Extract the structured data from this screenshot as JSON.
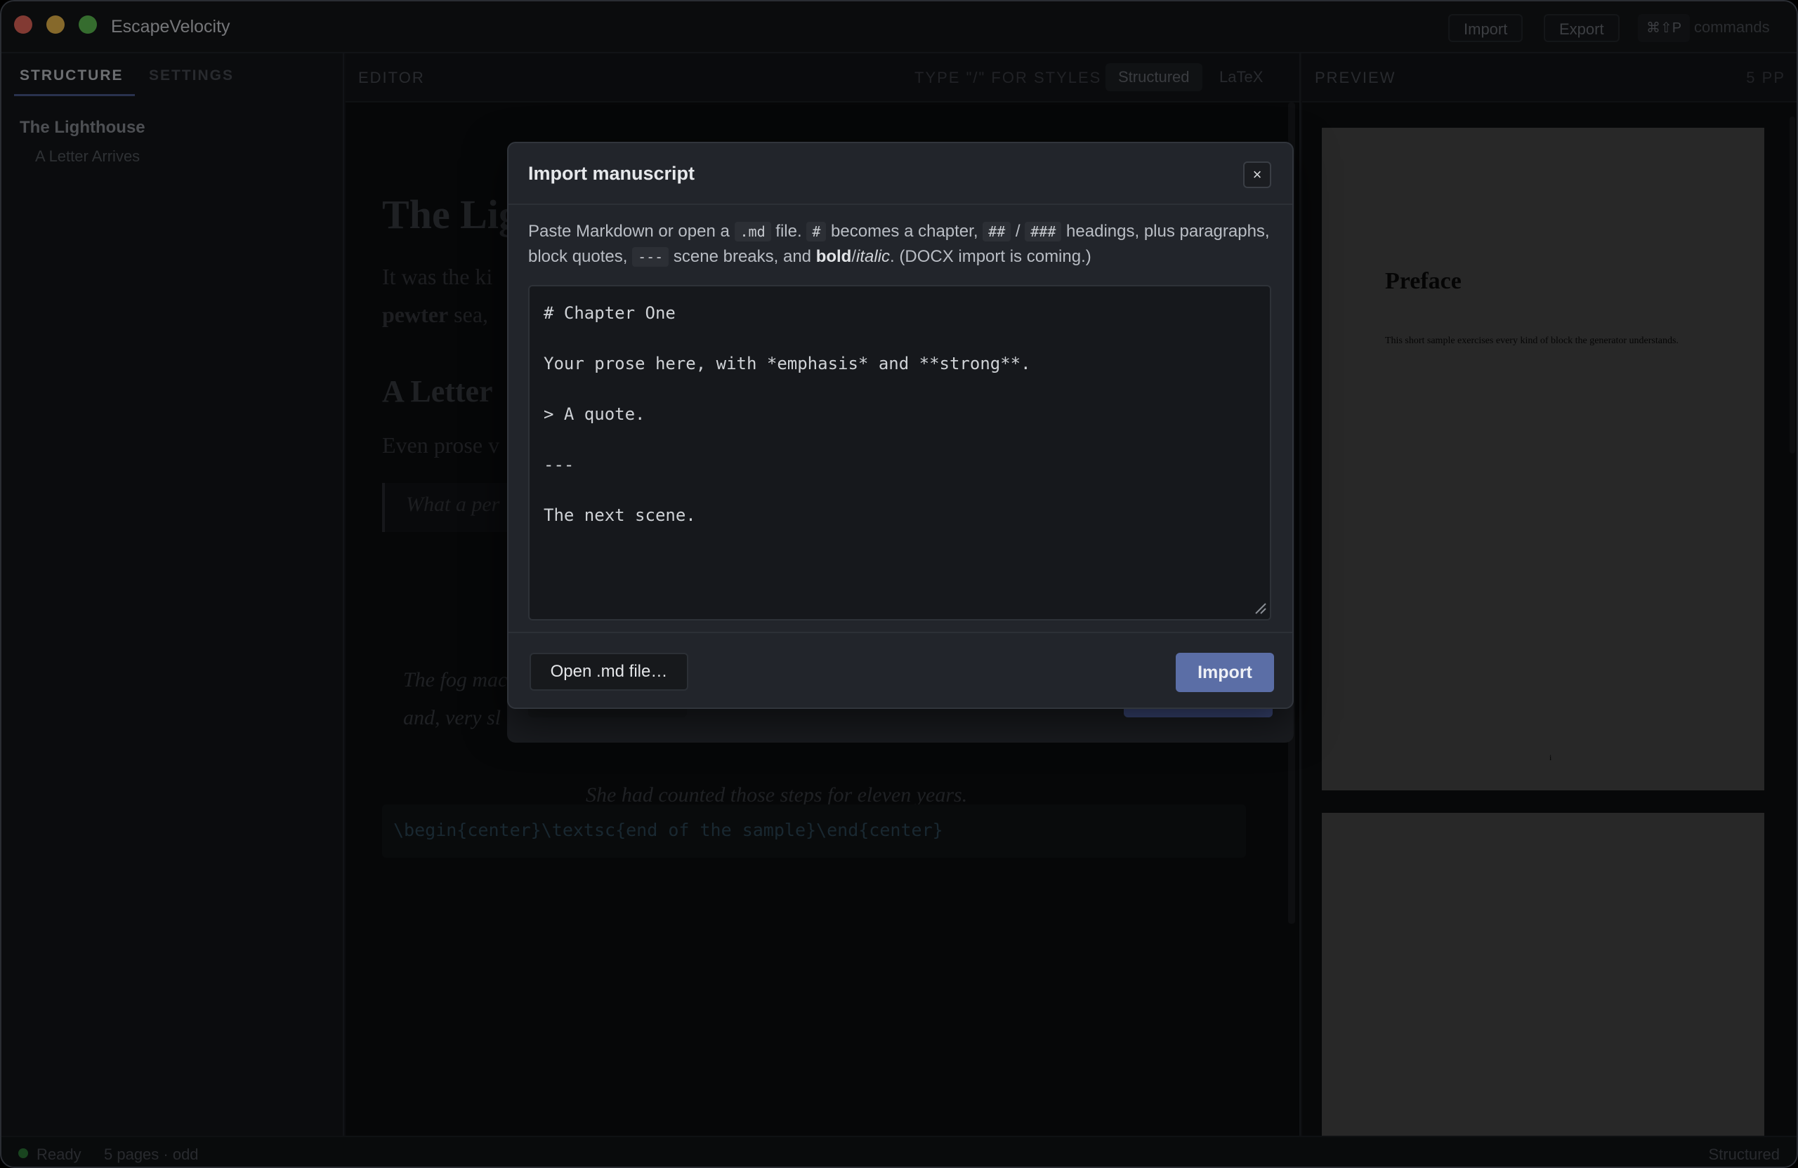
{
  "app": {
    "title": "EscapeVelocity",
    "import_label": "Import",
    "export_label": "Export",
    "shortcut": "⌘⇧P",
    "commands_label": "commands"
  },
  "sidebar": {
    "tabs": [
      {
        "label": "STRUCTURE"
      },
      {
        "label": "SETTINGS"
      }
    ],
    "items": [
      {
        "label": "The Lighthouse"
      },
      {
        "label": "A Letter Arrives"
      }
    ]
  },
  "editor": {
    "label": "EDITOR",
    "style_hint": "TYPE \"/\" FOR STYLES",
    "modes": [
      {
        "label": "Structured"
      },
      {
        "label": "LaTeX"
      }
    ],
    "doc": {
      "h1": "The Lig",
      "p1_line1": "It was the ki",
      "p1_line2_bold": "pewter",
      "p1_line2_rest": " sea,",
      "h2": "A Letter",
      "p2": "Even prose v",
      "quote": "What a per",
      "ital1": "The fog mac",
      "ital2": "and, very sl",
      "centered": "She had counted those steps for eleven years.",
      "latex": "\\begin{center}\\textsc{end of the sample}\\end{center}"
    }
  },
  "preview": {
    "label": "PREVIEW",
    "page_count": "5 PP",
    "page1": {
      "title": "Preface",
      "text": "This short sample exercises every kind of block the generator understands.",
      "number": "i"
    }
  },
  "status": {
    "ready": "Ready",
    "pages": "5 pages · odd",
    "mode": "Structured"
  },
  "modal": {
    "title": "Import manuscript",
    "close": "×",
    "desc": {
      "t1": "Paste Markdown or open a ",
      "c1": ".md",
      "t2": " file. ",
      "c2": "#",
      "t3": " becomes a chapter, ",
      "c3": "##",
      "t4": " / ",
      "c4": "###",
      "t5": " headings, plus paragraphs, block quotes, ",
      "c5": "---",
      "t6": " scene breaks, and ",
      "bold": "bold",
      "slash": "/",
      "italic": "italic",
      "t7": ". (DOCX import is coming.)"
    },
    "textarea_value": "# Chapter One\n\nYour prose here, with *emphasis* and **strong**.\n\n> A quote.\n\n---\n\nThe next scene.",
    "open_button": "Open .md file…",
    "import_button": "Import"
  }
}
